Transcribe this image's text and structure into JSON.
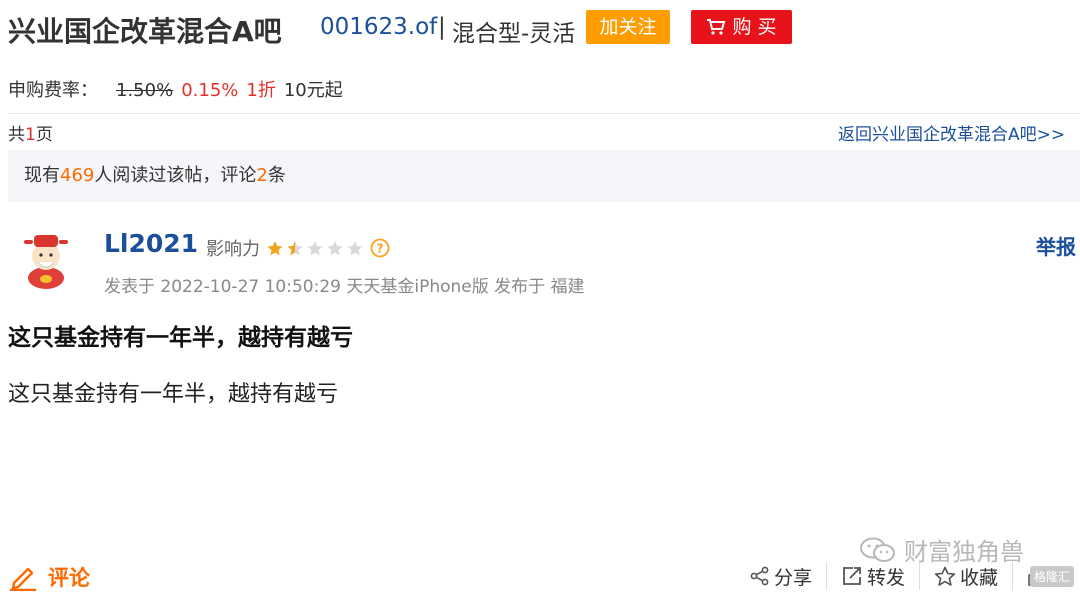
{
  "header": {
    "title": "兴业国企改革混合A吧",
    "code": "001623.of",
    "separator": "|",
    "fund_type": "混合型-灵活",
    "follow_label": "加关注",
    "buy_label": "购 买"
  },
  "fee": {
    "label": "申购费率：",
    "original": "1.50%",
    "discounted": "0.15%",
    "discount": "1折",
    "minimum": "10元起"
  },
  "pagination": {
    "prefix": "共",
    "count": "1",
    "suffix": "页",
    "back_link": "返回兴业国企改革混合A吧>>"
  },
  "stats": {
    "prefix": "现有",
    "readers": "469",
    "middle": "人阅读过该帖，评论",
    "comments": "2",
    "suffix": "条"
  },
  "post": {
    "username": "Ll2021",
    "influence_label": "影响力",
    "influence_stars": 1.5,
    "max_stars": 5,
    "report_label": "举报",
    "meta": "发表于 2022-10-27 10:50:29 天天基金iPhone版 发布于 福建",
    "title": "这只基金持有一年半，越持有越亏",
    "body": "这只基金持有一年半，越持有越亏"
  },
  "watermark": "财富独角兽",
  "footer": {
    "comment_label": "评论",
    "share_label": "分享",
    "forward_label": "转发",
    "collect_label": "收藏",
    "like_badge": "格隆汇"
  },
  "colors": {
    "link_blue": "#1b4f9c",
    "follow_orange": "#ff9c00",
    "buy_red": "#e8121a",
    "accent_orange": "#ff6a00",
    "price_red": "#e0322b"
  }
}
